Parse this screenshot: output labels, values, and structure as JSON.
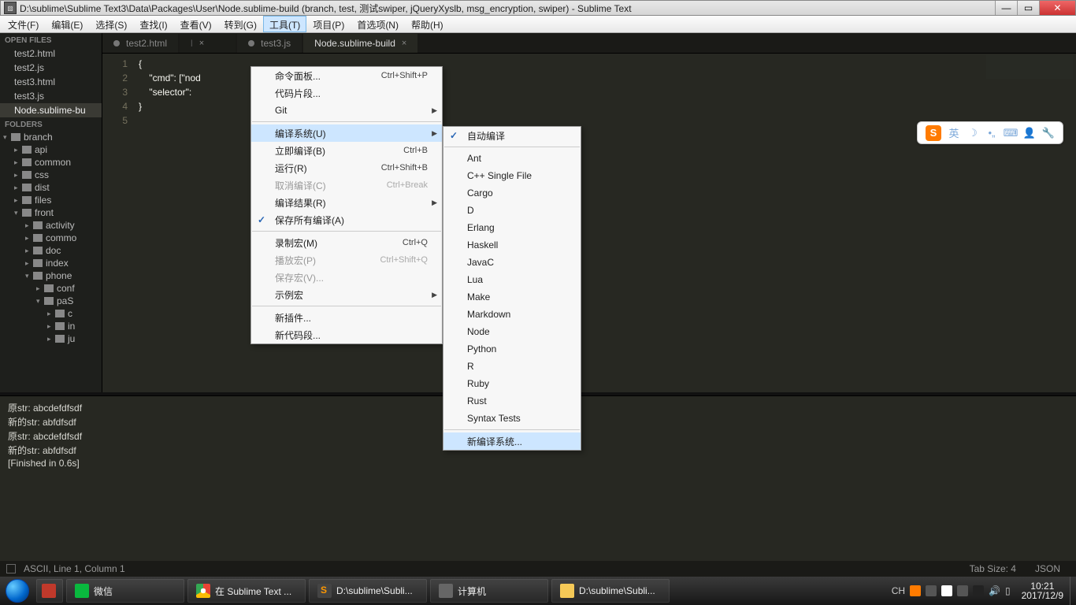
{
  "titlebar": {
    "path": "D:\\sublime\\Sublime Text3\\Data\\Packages\\User\\Node.sublime-build (branch, test, 测试swiper, jQueryXyslb, msg_encryption, swiper) - Sublime Text"
  },
  "menubar": {
    "items": [
      "文件(F)",
      "编辑(E)",
      "选择(S)",
      "查找(I)",
      "查看(V)",
      "转到(G)",
      "工具(T)",
      "项目(P)",
      "首选项(N)",
      "帮助(H)"
    ],
    "active_index": 6
  },
  "sidebar": {
    "open_files_header": "OPEN FILES",
    "open_files": [
      "test2.html",
      "test2.js",
      "test3.html",
      "test3.js",
      "Node.sublime-bu"
    ],
    "open_files_active": 4,
    "folders_header": "FOLDERS",
    "tree": [
      {
        "d": 0,
        "open": true,
        "label": "branch"
      },
      {
        "d": 1,
        "open": false,
        "label": "api"
      },
      {
        "d": 1,
        "open": false,
        "label": "common"
      },
      {
        "d": 1,
        "open": false,
        "label": "css"
      },
      {
        "d": 1,
        "open": false,
        "label": "dist"
      },
      {
        "d": 1,
        "open": false,
        "label": "files"
      },
      {
        "d": 1,
        "open": true,
        "label": "front"
      },
      {
        "d": 2,
        "open": false,
        "label": "activity"
      },
      {
        "d": 2,
        "open": false,
        "label": "commo"
      },
      {
        "d": 2,
        "open": false,
        "label": "doc"
      },
      {
        "d": 2,
        "open": false,
        "label": "index"
      },
      {
        "d": 2,
        "open": true,
        "label": "phone"
      },
      {
        "d": 3,
        "open": false,
        "label": "conf"
      },
      {
        "d": 3,
        "open": true,
        "label": "paS"
      },
      {
        "d": 4,
        "open": false,
        "label": "c"
      },
      {
        "d": 4,
        "open": false,
        "label": "in"
      },
      {
        "d": 4,
        "open": false,
        "label": "ju"
      }
    ]
  },
  "tabs": {
    "items": [
      {
        "label": "test2.html",
        "dirty": true,
        "active": false
      },
      {
        "label": "l",
        "phantom": true
      },
      {
        "label": "test3.js",
        "dirty": true,
        "active": false
      },
      {
        "label": "Node.sublime-build",
        "active": true
      }
    ]
  },
  "editor": {
    "lines": [
      "{",
      "    \"cmd\": [\"nod",
      "    \"selector\":",
      "}",
      ""
    ],
    "linenos": [
      "1",
      "2",
      "3",
      "4",
      "5"
    ]
  },
  "tools_menu": {
    "items": [
      {
        "label": "命令面板...",
        "shortcut": "Ctrl+Shift+P"
      },
      {
        "label": "代码片段..."
      },
      {
        "label": "Git",
        "submenu": true
      },
      {
        "sep": true
      },
      {
        "label": "编译系统(U)",
        "submenu": true,
        "hover": true
      },
      {
        "label": "立即编译(B)",
        "shortcut": "Ctrl+B"
      },
      {
        "label": "运行(R)",
        "shortcut": "Ctrl+Shift+B"
      },
      {
        "label": "取消编译(C)",
        "shortcut": "Ctrl+Break",
        "disabled": true
      },
      {
        "label": "编译结果(R)",
        "submenu": true
      },
      {
        "label": "保存所有编译(A)",
        "checked": true
      },
      {
        "sep": true
      },
      {
        "label": "录制宏(M)",
        "shortcut": "Ctrl+Q"
      },
      {
        "label": "播放宏(P)",
        "shortcut": "Ctrl+Shift+Q",
        "disabled": true
      },
      {
        "label": "保存宏(V)...",
        "disabled": true
      },
      {
        "label": "示例宏",
        "submenu": true
      },
      {
        "sep": true
      },
      {
        "label": "新插件..."
      },
      {
        "label": "新代码段..."
      }
    ]
  },
  "build_menu": {
    "items": [
      {
        "label": "自动编译",
        "checked": true
      },
      {
        "sep": true
      },
      {
        "label": "Ant"
      },
      {
        "label": "C++ Single File"
      },
      {
        "label": "Cargo"
      },
      {
        "label": "D"
      },
      {
        "label": "Erlang"
      },
      {
        "label": "Haskell"
      },
      {
        "label": "JavaC"
      },
      {
        "label": "Lua"
      },
      {
        "label": "Make"
      },
      {
        "label": "Markdown"
      },
      {
        "label": "Node"
      },
      {
        "label": "Python"
      },
      {
        "label": "R"
      },
      {
        "label": "Ruby"
      },
      {
        "label": "Rust"
      },
      {
        "label": "Syntax Tests"
      },
      {
        "sep": true
      },
      {
        "label": "新编译系统...",
        "hover": true
      }
    ]
  },
  "console": {
    "lines": [
      "原str: abcdefdfsdf",
      "新的str: abfdfsdf",
      "原str: abcdefdfsdf",
      "新的str: abfdfsdf",
      "[Finished in 0.6s]"
    ]
  },
  "statusbar": {
    "left": "ASCII, Line 1, Column 1",
    "tab": "Tab Size: 4",
    "lang": "JSON"
  },
  "ime": {
    "lang": "英"
  },
  "taskbar": {
    "items": [
      {
        "icon": "wechat",
        "label": "微信"
      },
      {
        "icon": "chrome",
        "label": "在 Sublime Text ..."
      },
      {
        "icon": "subl",
        "label": "D:\\sublime\\Subli..."
      },
      {
        "icon": "pc",
        "label": "计算机"
      },
      {
        "icon": "folder",
        "label": "D:\\sublime\\Subli..."
      }
    ],
    "tray_lang": "CH",
    "time": "10:21",
    "date": "2017/12/9"
  }
}
